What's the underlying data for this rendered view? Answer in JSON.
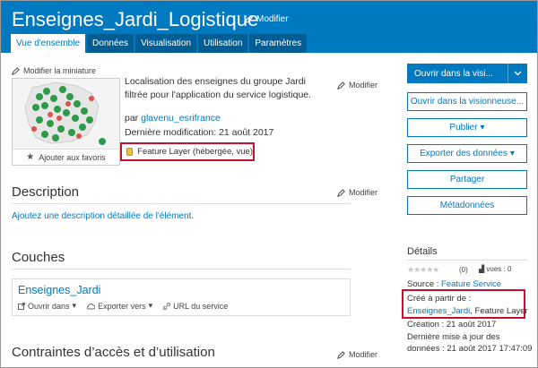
{
  "header": {
    "title": "Enseignes_Jardi_Logistique",
    "edit_label": "Modifier",
    "tabs": [
      {
        "label": "Vue d'ensemble",
        "active": true
      },
      {
        "label": "Données"
      },
      {
        "label": "Visualisation"
      },
      {
        "label": "Utilisation"
      },
      {
        "label": "Paramètres"
      }
    ]
  },
  "overview": {
    "modify_thumbnail": "Modifier la miniature",
    "add_favorites": "Ajouter aux favoris",
    "summary": "Localisation des enseignes du groupe Jardi filtrée pour l'application du service logistique.",
    "edit_label": "Modifier",
    "owner_prefix": "par",
    "owner": "glavenu_esrifrance",
    "last_modified": "Dernière modification: 21 août 2017",
    "item_type": "Feature Layer (hébergée, vue)"
  },
  "description": {
    "title": "Description",
    "edit_label": "Modifier",
    "add_link": "Ajoutez une description détaillée de l'élément."
  },
  "layers": {
    "title": "Couches",
    "items": [
      {
        "name": "Enseignes_Jardi",
        "open_in": "Ouvrir dans",
        "export_to": "Exporter vers",
        "service_url": "URL du service"
      }
    ]
  },
  "constraints": {
    "title": "Contraintes d’accès et d’utilisation",
    "edit_label": "Modifier"
  },
  "actions": {
    "open_viewer_short": "Ouvrir dans la visi...",
    "open_viewer_long": "Ouvrir dans la visionneuse...",
    "publish": "Publier",
    "export_data": "Exporter des données",
    "share": "Partager",
    "metadata": "Métadonnées"
  },
  "details": {
    "title": "Détails",
    "rating": "(0)",
    "views": "vues : 0",
    "source_label": "Source :",
    "source_value": "Feature Service",
    "created_from_label": "Créé à partir de :",
    "created_from_link": "Enseignes_Jardi",
    "created_from_type": ", Feature Layer",
    "created": "Création : 21 août 2017",
    "updated": "Dernière mise à jour des données : 21 août 2017 17:47:09"
  },
  "colors": {
    "brand": "#0079c1",
    "tab_inactive": "#005e95",
    "highlight": "#c8102e"
  }
}
